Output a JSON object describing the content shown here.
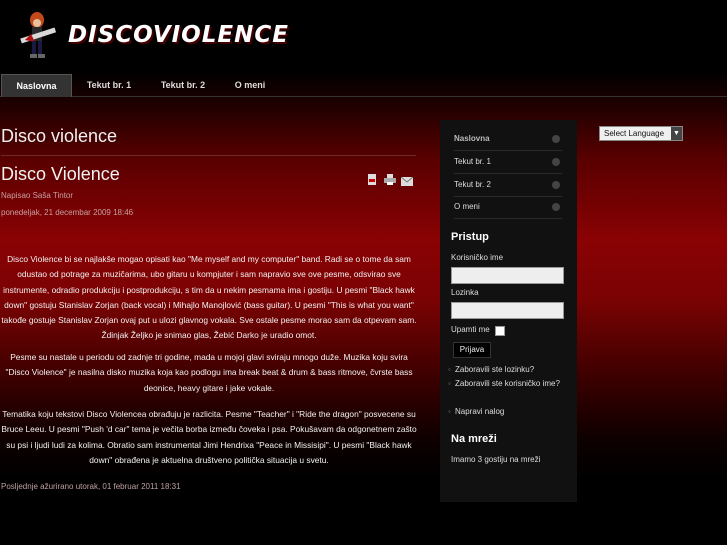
{
  "logo": {
    "text": "DISCOVIOLENCE",
    "icon": "guitarist-logo-icon"
  },
  "nav": {
    "items": [
      {
        "label": "Naslovna",
        "active": true
      },
      {
        "label": "Tekut br. 1",
        "active": false
      },
      {
        "label": "Tekut br. 2",
        "active": false
      },
      {
        "label": "O meni",
        "active": false
      }
    ]
  },
  "main": {
    "section_title": "Disco violence",
    "article": {
      "title": "Disco Violence",
      "author": "Napisao Saša Tintor",
      "date": "ponedeljak, 21 decembar 2009 18:46",
      "icons": [
        "pdf-icon",
        "print-icon",
        "email-icon"
      ],
      "paragraphs": [
        "Disco Violence bi se najlakše mogao opisati kao \"Me myself and my computer\" band. Radi se o tome da sam odustao od potrage za muzičarima, ubo gitaru u kompjuter i sam napravio sve ove pesme, odsvirao sve instrumente, odradio produkciju i postprodukciju, s tim da u nekim pesmama ima i gostiju. U pesmi \"Black hawk down\" gostuju Stanislav Zorjan (back vocal) i Mihajlo Manojlović (bass guitar). U pesmi \"This is what you want\" takođe gostuje Stanislav Zorjan ovaj put u ulozi glavnog vokala. Sve ostale pesme morao sam da otpevam sam. Ždinjak Željko je snimao glas, Žebić Darko je uradio omot.",
        "Pesme su nastale u periodu od zadnje tri godine, mada u mojoj glavi sviraju mnogo duže. Muzika koju svira \"Disco Violence\" je nasilna disko muzika koja kao podlogu ima break beat & drum & bass ritmove, čvrste bass deonice, heavy gitare i jake vokale.",
        "Tematika koju tekstovi Disco Violencea obrađuju je razlicita. Pesme \"Teacher\" i \"Ride the dragon\" posvecene su Bruce Leeu. U pesmi \"Push 'd car\" tema je večita borba između čoveka i psa. Pokušavam da odgonetnem zašto su psi i ljudi ludi za kolima. Obratio sam instrumental Jimi Hendrixa \"Peace in Missisipi\". U pesmi \"Black hawk down\" obrađena je aktuelna društveno politička situacija u svetu."
      ],
      "last_updated": "Posljednje ažurirano utorak, 01 februar 2011 18:31"
    }
  },
  "sidebar": {
    "menu": [
      {
        "label": "Naslovna",
        "active": true
      },
      {
        "label": "Tekut br. 1",
        "active": false
      },
      {
        "label": "Tekut br. 2",
        "active": false
      },
      {
        "label": "O meni",
        "active": false
      }
    ],
    "login": {
      "heading": "Pristup",
      "username_label": "Korisničko ime",
      "username_value": "",
      "password_label": "Lozinka",
      "password_value": "",
      "remember_label": "Upamti me",
      "submit_label": "Prijava",
      "links": [
        "Zaboravili ste lozinku?",
        "Zaboravili ste korisničko ime?",
        "Napravi nalog"
      ]
    },
    "online": {
      "heading": "Na mreži",
      "text": "Imamo 3 gostiju na mreži"
    }
  },
  "language_select": {
    "label": "Select Language"
  },
  "colors": {
    "background_red": "#8a0204",
    "header_black": "#000000",
    "sidebar": "#111111"
  }
}
